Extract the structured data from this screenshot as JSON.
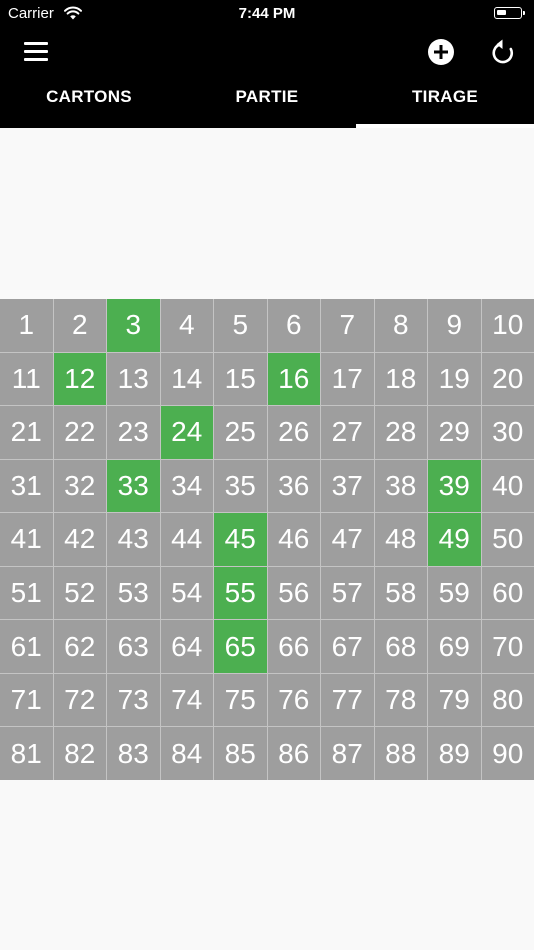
{
  "status_bar": {
    "carrier": "Carrier",
    "time": "7:44 PM"
  },
  "toolbar": {
    "menu_icon": "menu-icon",
    "add_icon": "add-circle-icon",
    "reset_icon": "reset-icon"
  },
  "tabs": [
    {
      "label": "CARTONS",
      "active": false
    },
    {
      "label": "PARTIE",
      "active": false
    },
    {
      "label": "TIRAGE",
      "active": true
    }
  ],
  "numbers": {
    "max": 90,
    "columns": 10,
    "drawn": [
      3,
      12,
      16,
      24,
      33,
      39,
      45,
      49,
      55,
      65
    ]
  },
  "colors": {
    "header_bg": "#000000",
    "cell_default": "#9e9e9e",
    "cell_drawn": "#4caf50",
    "page_bg": "#f9f9f9"
  }
}
